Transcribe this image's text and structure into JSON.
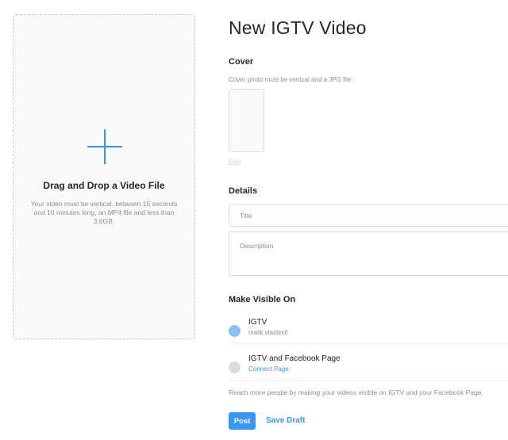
{
  "upload": {
    "title": "Drag and Drop a Video File",
    "help": "Your video must be vertical, between 15 seconds and 10 minutes long, an MP4 file and less than 3.6GB.",
    "icon": "plus-icon"
  },
  "page": {
    "title": "New IGTV Video"
  },
  "cover": {
    "label": "Cover",
    "help": "Cover photo must be vertical and a JPG file.",
    "edit_label": "Edit"
  },
  "details": {
    "label": "Details",
    "title_placeholder": "Title",
    "description_placeholder": "Description"
  },
  "visibility": {
    "label": "Make Visible On",
    "options": [
      {
        "label": "IGTV",
        "sub": "malik.vlastimil",
        "selected": true
      },
      {
        "label": "IGTV and Facebook Page",
        "sub": "Connect Page",
        "selected": false
      }
    ],
    "reach_text": "Reach more people by making your videos visible on IGTV and your Facebook Page."
  },
  "actions": {
    "post_label": "Post",
    "draft_label": "Save Draft"
  },
  "colors": {
    "accent": "#3897f0",
    "radio_selected": "#8cc0f5",
    "radio_unselected": "#dbdbdb",
    "muted_text": "#8e8e8e"
  }
}
